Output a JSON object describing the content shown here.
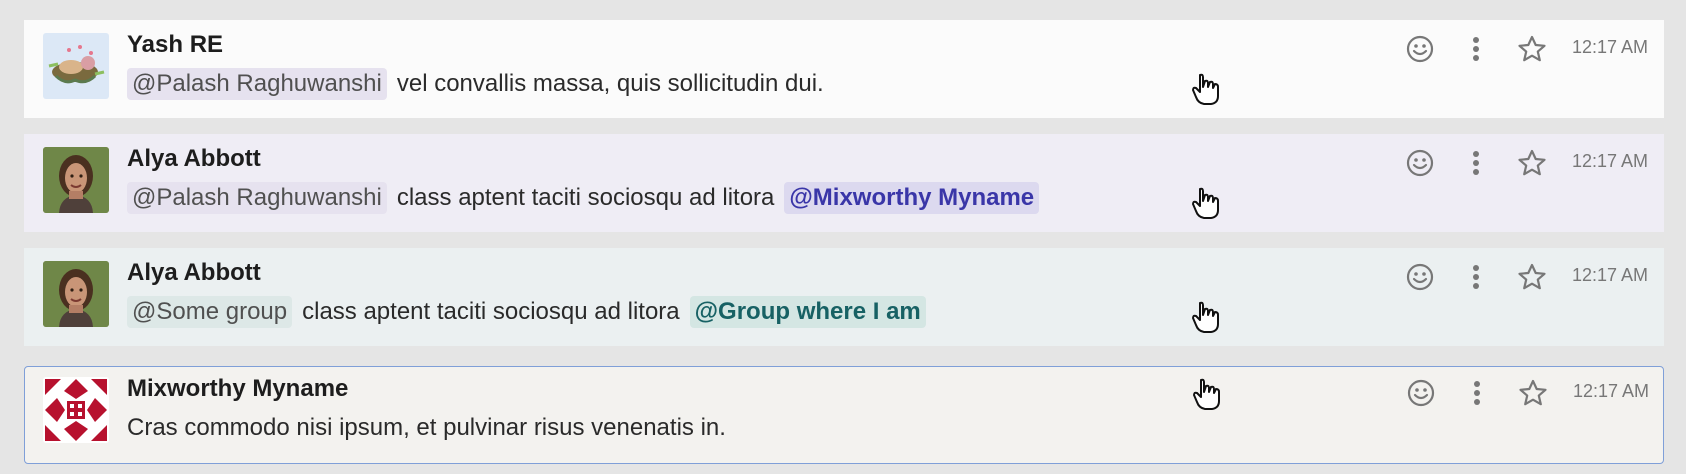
{
  "messages": [
    {
      "author": "Yash RE",
      "avatar_icon": "bird-nest-avatar-icon",
      "mention": "@Palash Raghuwanshi",
      "text": "vel convallis massa, quis sollicitudin dui.",
      "highlight_mention": "",
      "time": "12:17 AM"
    },
    {
      "author": "Alya Abbott",
      "avatar_icon": "portrait-avatar-icon",
      "mention": "@Palash Raghuwanshi",
      "text": "class aptent taciti sociosqu ad litora",
      "highlight_mention": "@Mixworthy Myname",
      "time": "12:17 AM"
    },
    {
      "author": "Alya Abbott",
      "avatar_icon": "portrait-avatar-icon",
      "mention": "@Some group",
      "text": "class aptent taciti sociosqu ad litora",
      "highlight_mention": "@Group where I am",
      "time": "12:17 AM"
    },
    {
      "author": "Mixworthy Myname",
      "avatar_icon": "geometric-pattern-avatar-icon",
      "mention": "",
      "text": "Cras commodo nisi ipsum, et pulvinar risus venenatis in.",
      "highlight_mention": "",
      "time": "12:17 AM"
    }
  ],
  "actions": {
    "emoji_icon": "smiley-icon",
    "menu_icon": "vertical-ellipsis-icon",
    "star_icon": "star-outline-icon",
    "cursor_icon": "hand-pointer-icon"
  },
  "colors": {
    "self_mention": "#3a36a8",
    "self_group": "#176164",
    "selected_border": "#7f9fd8"
  }
}
